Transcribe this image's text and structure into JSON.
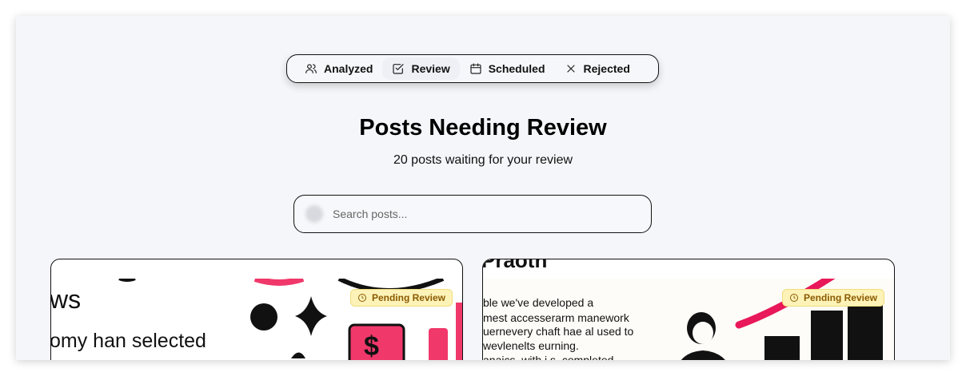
{
  "tabs": [
    {
      "label": "Analyzed",
      "icon": "users-icon"
    },
    {
      "label": "Review",
      "icon": "check-square-icon"
    },
    {
      "label": "Scheduled",
      "icon": "calendar-icon"
    },
    {
      "label": "Rejected",
      "icon": "x-icon"
    }
  ],
  "page": {
    "title": "Posts Needing Review",
    "subtitle": "20 posts waiting for your review"
  },
  "search": {
    "placeholder": "Search posts..."
  },
  "cards": [
    {
      "badge": "Pending Review",
      "image_text": {
        "line1": "ws",
        "line2": "omy han selected",
        "dollar": "$"
      },
      "accent": "#f0386b"
    },
    {
      "badge": "Pending Review",
      "image_text": {
        "top": "Praoth",
        "line1": "ble we've developed a",
        "line2": "mest accesserarm manework",
        "line3": "uernevery chaft hae al used to",
        "line4": "wevlenelts eurning.",
        "line5": "anaics, with i.s. completed"
      },
      "accent": "#e8185a"
    }
  ],
  "colors": {
    "badge_bg": "#fdf3b8",
    "badge_text": "#8a5a00",
    "accent_pink": "#f0386b",
    "page_bg": "#f5f6fa"
  }
}
